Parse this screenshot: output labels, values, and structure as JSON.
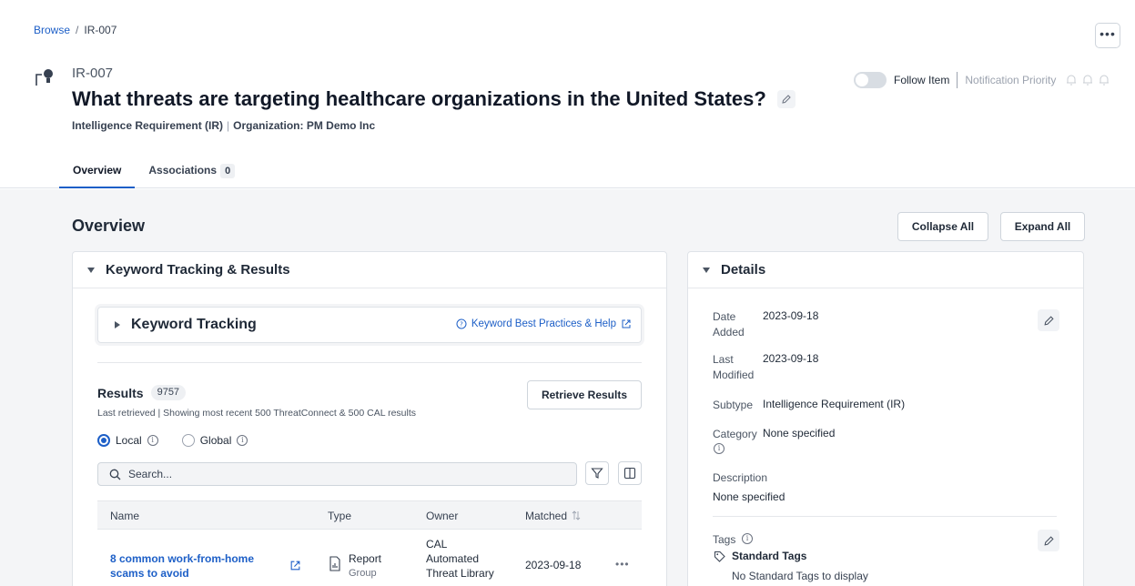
{
  "breadcrumb": {
    "root": "Browse",
    "separator": "/",
    "current": "IR-007"
  },
  "header": {
    "id": "IR-007",
    "title": "What threats are targeting healthcare organizations in the United States?",
    "type": "Intelligence Requirement (IR)",
    "organization": "Organization: PM Demo Inc",
    "follow_label": "Follow Item",
    "follow_on": false,
    "notification_label": "Notification Priority",
    "more_label": "•••"
  },
  "tabs": [
    {
      "label": "Overview",
      "active": true
    },
    {
      "label": "Associations",
      "count": "0"
    }
  ],
  "overview": {
    "title": "Overview",
    "collapse_all": "Collapse All",
    "expand_all": "Expand All"
  },
  "keyword_panel": {
    "title": "Keyword Tracking & Results",
    "keyword_tracking": "Keyword Tracking",
    "help_link": "Keyword Best Practices & Help",
    "results_label": "Results",
    "results_count": "9757",
    "retrieve_button": "Retrieve Results",
    "last_retrieved": "Last retrieved | Showing most recent 500 ThreatConnect & 500 CAL results",
    "scope_local": "Local",
    "scope_global": "Global",
    "selected_scope": "Local",
    "search_placeholder": "Search...",
    "columns": {
      "name": "Name",
      "type": "Type",
      "owner": "Owner",
      "matched": "Matched"
    },
    "rows": [
      {
        "name": "8 common work-from-home scams to avoid",
        "type_main": "Report",
        "type_sub": "Group",
        "owner": "CAL Automated Threat Library",
        "matched": "2023-09-18",
        "actions": "•••"
      }
    ]
  },
  "details_panel": {
    "title": "Details",
    "date_added_label": "Date Added",
    "date_added": "2023-09-18",
    "last_modified_label": "Last Modified",
    "last_modified": "2023-09-18",
    "subtype_label": "Subtype",
    "subtype": "Intelligence Requirement (IR)",
    "category_label": "Category",
    "category": "None specified",
    "description_label": "Description",
    "description": "None specified",
    "tags_label": "Tags",
    "standard_tags_label": "Standard Tags",
    "standard_tags_empty": "No Standard Tags to display"
  },
  "colors": {
    "accent": "#1d5fc7",
    "background": "#f4f5f7",
    "border": "#dfe3e8"
  }
}
